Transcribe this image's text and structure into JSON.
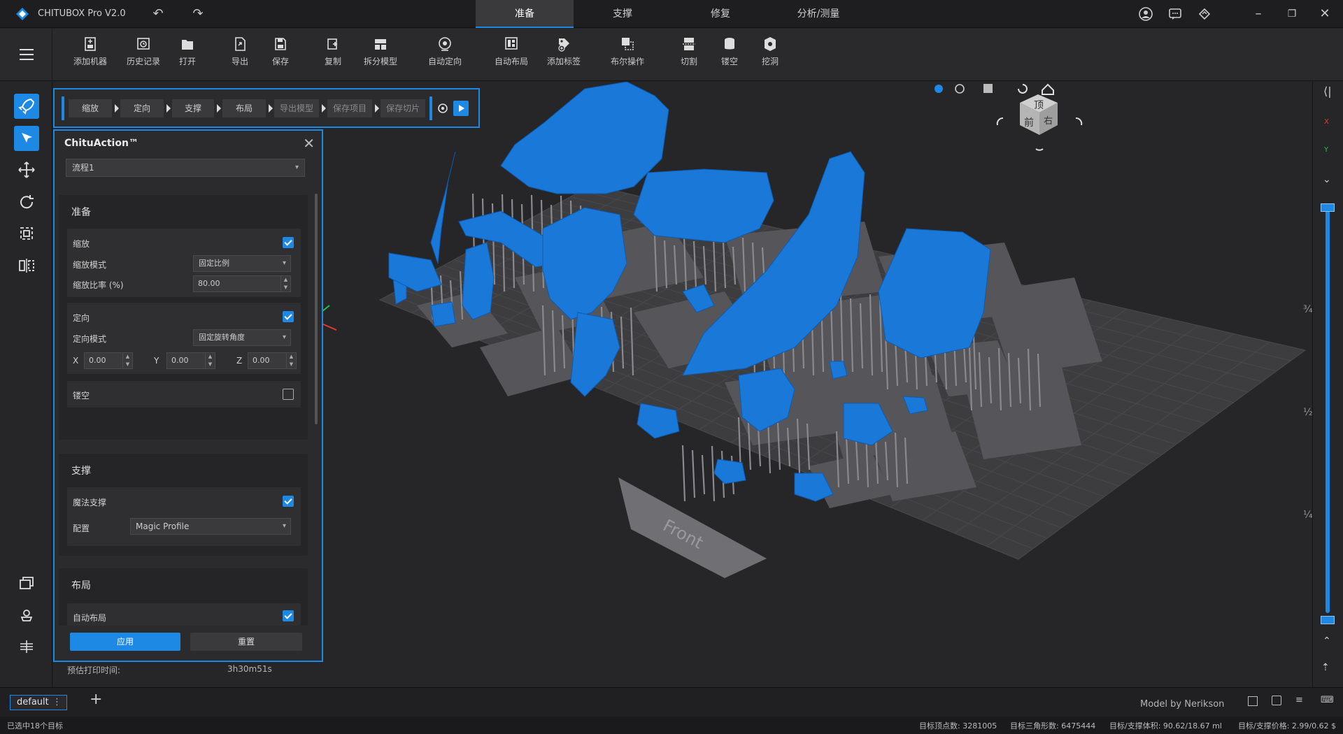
{
  "titlebar": {
    "app_title": "CHITUBOX Pro V2.0",
    "tabs": [
      {
        "label": "准备",
        "active": true
      },
      {
        "label": "支撑"
      },
      {
        "label": "修复"
      },
      {
        "label": "分析/测量"
      }
    ]
  },
  "toolbar": {
    "items": [
      {
        "label": "添加机器",
        "icon": "add-machine-icon"
      },
      {
        "label": "历史记录",
        "icon": "history-icon"
      },
      {
        "label": "打开",
        "icon": "open-folder-icon"
      },
      {
        "label": "导出",
        "icon": "export-icon"
      },
      {
        "label": "保存",
        "icon": "save-icon"
      },
      {
        "label": "复制",
        "icon": "copy-icon"
      },
      {
        "label": "拆分模型",
        "icon": "split-model-icon"
      },
      {
        "label": "自动定向",
        "icon": "auto-orient-icon"
      },
      {
        "label": "自动布局",
        "icon": "auto-layout-icon"
      },
      {
        "label": "添加标签",
        "icon": "add-label-icon"
      },
      {
        "label": "布尔操作",
        "icon": "boolean-icon"
      },
      {
        "label": "切割",
        "icon": "cut-icon"
      },
      {
        "label": "镂空",
        "icon": "hollow-icon"
      },
      {
        "label": "挖洞",
        "icon": "dig-hole-icon"
      }
    ]
  },
  "workflow": {
    "steps": [
      {
        "label": "缩放"
      },
      {
        "label": "定向"
      },
      {
        "label": "支撑"
      },
      {
        "label": "布局"
      },
      {
        "label": "导出模型",
        "dim": true
      },
      {
        "label": "保存项目",
        "dim": true
      },
      {
        "label": "保存切片",
        "dim": true
      }
    ]
  },
  "panel": {
    "title": "ChituAction™",
    "flow": "流程1",
    "prepare": {
      "title": "准备",
      "scale_label": "缩放",
      "scale_mode_label": "缩放模式",
      "scale_mode": "固定比例",
      "scale_ratio_label": "缩放比率 (%)",
      "scale_ratio": "80.00",
      "orient_label": "定向",
      "orient_mode_label": "定向模式",
      "orient_mode": "固定旋转角度",
      "x_label": "X",
      "x": "0.00",
      "y_label": "Y",
      "y": "0.00",
      "z_label": "Z",
      "z": "0.00",
      "hollow_label": "镂空"
    },
    "support": {
      "title": "支撑",
      "magic_label": "魔法支撑",
      "profile_label": "配置",
      "profile": "Magic Profile"
    },
    "layout": {
      "title": "布局",
      "auto_label": "自动布局"
    },
    "apply": "应用",
    "reset": "重置"
  },
  "estimate": {
    "label": "预估打印时间:",
    "value": "3h30m51s"
  },
  "viewport": {
    "plate_label": "Front",
    "cube_top": "顶",
    "cube_front": "前",
    "cube_right": "右",
    "axis_x": "X",
    "axis_y": "Y",
    "slider_marks": [
      "¾",
      "½",
      "¼"
    ]
  },
  "bottom": {
    "tab": "default",
    "credit": "Model by Nerikson"
  },
  "status": {
    "selected": "已选中18个目标",
    "vertices": "目标顶点数: 3281005",
    "triangles": "目标三角形数: 6475444",
    "volume": "目标/支撑体积: 90.62/18.67 ml",
    "price": "目标/支撑价格: 2.99/0.62 $"
  },
  "colors": {
    "accent": "#1e88e5",
    "model": "#1a78d8",
    "support": "#8a8a8e",
    "plate": "#3d3d40"
  }
}
